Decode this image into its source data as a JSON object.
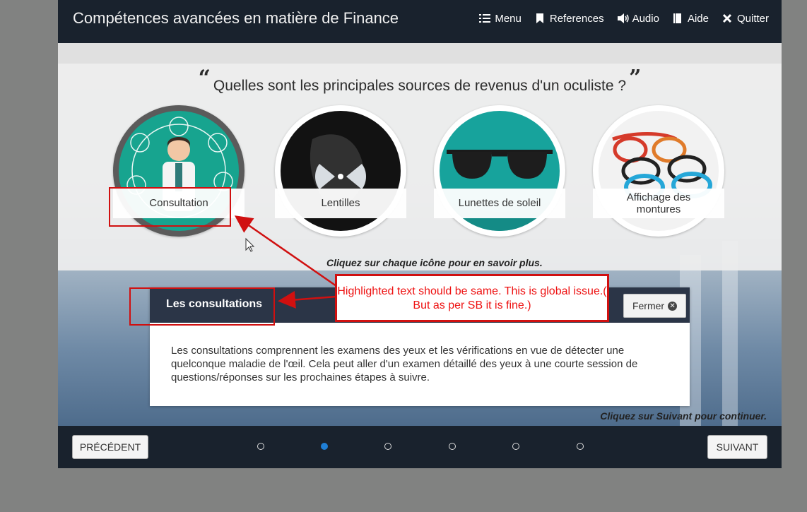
{
  "app": {
    "title": "Compétences avancées en matière de Finance"
  },
  "topnav": [
    {
      "label": "Menu",
      "icon": "list-icon"
    },
    {
      "label": "References",
      "icon": "bookmark-icon"
    },
    {
      "label": "Audio",
      "icon": "speaker-icon"
    },
    {
      "label": "Aide",
      "icon": "help-book-icon"
    },
    {
      "label": "Quitter",
      "icon": "close-icon"
    }
  ],
  "question": {
    "text": "Quelles sont les principales sources de revenus d'un oculiste ?"
  },
  "cards": [
    {
      "label": "Consultation"
    },
    {
      "label": "Lentilles"
    },
    {
      "label": "Lunettes de soleil"
    },
    {
      "label_line1": "Affichage des",
      "label_line2": "montures"
    }
  ],
  "hint_click_icon": "Cliquez sur chaque icône pour en savoir plus.",
  "popup": {
    "title": "Les consultations",
    "close_label": "Fermer",
    "body": "Les consultations comprennent les examens des yeux et les vérifications en vue de détecter une quelconque maladie de l'œil. Cela peut aller d'un examen détaillé des yeux à une courte session de questions/réponses sur les prochaines étapes à suivre."
  },
  "hint_next": "Cliquez sur Suivant pour continuer.",
  "bottombar": {
    "prev_label": "PRÉCÉDENT",
    "next_label": "SUIVANT",
    "pages_total": 6,
    "current_page": 2
  },
  "annotation": {
    "note": "Highlighted text should be same. This is global issue.( But as per SB it is fine.)",
    "color": "#d01010"
  }
}
